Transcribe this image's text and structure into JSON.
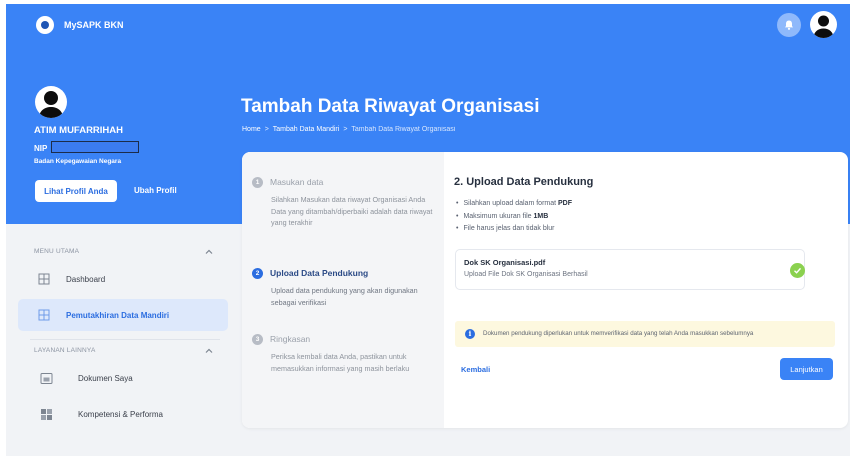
{
  "app": {
    "title": "MySAPK BKN"
  },
  "profile": {
    "name": "ATIM MUFARRIHAH",
    "nip_label": "NIP",
    "agency": "Badan Kepegawaian Negara",
    "view_profile_label": "Lihat Profil Anda",
    "edit_profile_label": "Ubah Profil"
  },
  "page": {
    "title": "Tambah Data Riwayat Organisasi",
    "breadcrumb": [
      "Home",
      "Tambah Data Mandiri",
      "Tambah Data Riwayat Organisasi"
    ],
    "breadcrumb_sep": ">"
  },
  "sidebar": {
    "sections": [
      {
        "label": "MENU UTAMA",
        "items": [
          {
            "label": "Dashboard",
            "icon": "dashboard-icon",
            "active": false
          },
          {
            "label": "Pemutakhiran Data Mandiri",
            "icon": "data-update-icon",
            "active": true
          }
        ]
      },
      {
        "label": "LAYANAN LAINNYA",
        "items": [
          {
            "label": "Dokumen Saya",
            "icon": "document-icon",
            "active": false
          },
          {
            "label": "Kompetensi & Performa",
            "icon": "competency-icon",
            "active": false
          }
        ]
      }
    ]
  },
  "steps": [
    {
      "number": "1",
      "title": "Masukan data",
      "description": "Silahkan Masukan data riwayat Organisasi Anda\nData yang ditambah/diperbaiki adalah data riwayat yang terakhir",
      "active": false
    },
    {
      "number": "2",
      "title": "Upload Data Pendukung",
      "description": "Upload data pendukung yang akan digunakan sebagai verifikasi",
      "active": true
    },
    {
      "number": "3",
      "title": "Ringkasan",
      "description": "Periksa kembali data Anda, pastikan untuk memasukkan informasi yang masih berlaku",
      "active": false
    }
  ],
  "upload": {
    "title": "2. Upload Data Pendukung",
    "requirements": [
      {
        "text": "Silahkan upload dalam format ",
        "bold": "PDF"
      },
      {
        "text": "Maksimum ukuran file ",
        "bold": "1MB"
      },
      {
        "text": "File harus jelas dan tidak blur",
        "bold": ""
      }
    ],
    "file_name": "Dok SK Organisasi.pdf",
    "file_status": "Upload File Dok SK Organisasi Berhasil",
    "notice": "Dokumen pendukung diperlukan untuk memverifikasi data yang telah Anda masukkan sebelumnya",
    "back_label": "Kembali",
    "next_label": "Lanjutkan"
  },
  "colors": {
    "primary": "#3a83f6",
    "link": "#2b6de0",
    "success": "#8bd14f",
    "notice_bg": "#fdf8df",
    "active_nav_bg": "#dde8fb"
  }
}
